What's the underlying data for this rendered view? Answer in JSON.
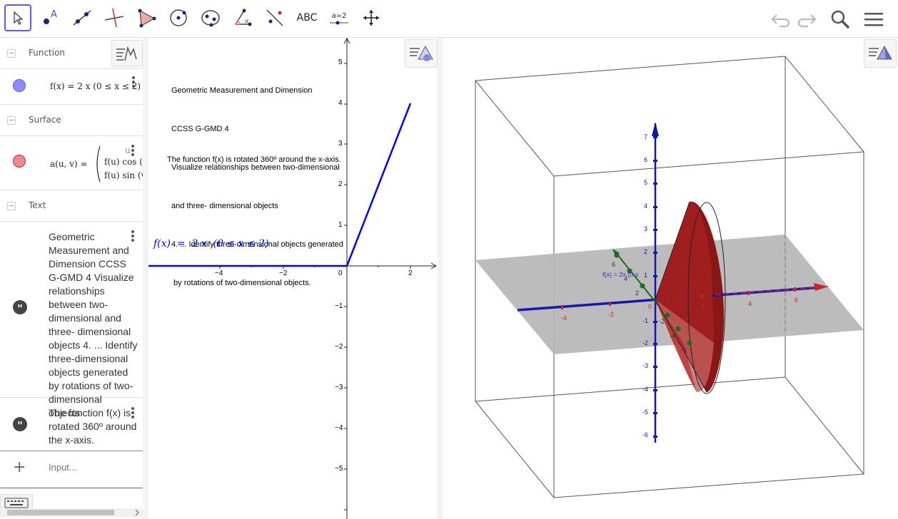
{
  "toolbar": {
    "tools": [
      {
        "name": "move-tool",
        "label": ""
      },
      {
        "name": "point-tool",
        "label": ""
      },
      {
        "name": "line-tool",
        "label": ""
      },
      {
        "name": "perpendicular-line-tool",
        "label": ""
      },
      {
        "name": "polygon-tool",
        "label": ""
      },
      {
        "name": "circle-tool",
        "label": ""
      },
      {
        "name": "ellipse-tool",
        "label": ""
      },
      {
        "name": "angle-tool",
        "label": ""
      },
      {
        "name": "reflect-tool",
        "label": ""
      },
      {
        "name": "text-tool",
        "label": "ABC"
      },
      {
        "name": "slider-tool",
        "label": "a=2"
      },
      {
        "name": "move-graphics-view-tool",
        "label": ""
      }
    ]
  },
  "algebra": {
    "sections": [
      {
        "title": "Function"
      },
      {
        "title": "Surface"
      },
      {
        "title": "Text"
      }
    ],
    "function_row": {
      "formula": "f(x)  =  2 x  (0 ≤ x ≤ 2)",
      "color": "#6f6fff"
    },
    "surface_row": {
      "lhs": "a(u, v)  =",
      "line1": "f(u)  cos (",
      "line2": "f(u)  sin (v",
      "corner": "u",
      "color": "#e86a6a"
    },
    "text_row_1": "Geometric Measurement and Dimension CCSS G-GMD 4 Visualize relationships between two-dimensional and three- dimensional objects 4. ... Identify three-dimensional objects generated by rotations of two-dimensional objects.",
    "text_row_2": "The function f(x) is rotated 360º around the x-axis.",
    "input_placeholder": "Input..."
  },
  "graphics2d": {
    "text_lines": [
      "Geometric Measurement and Dimension",
      "CCSS G-GMD 4",
      "Visualize relationships between two-dimensional",
      "and three- dimensional objects",
      "4. ... Identify three-dimensional objects generated",
      " by rotations of two-dimensional objects."
    ],
    "rotation_text": "The function f(x) is rotated 360º around the x-axis.",
    "function_label": "f(x)  =  2 x  (0 ≤ x ≤ 2)",
    "x_ticks": [
      "−4",
      "−2",
      "0",
      "2"
    ],
    "y_ticks": [
      "5",
      "4",
      "3",
      "2",
      "1",
      "−1",
      "−2",
      "−3",
      "−4",
      "−5"
    ],
    "line_color": "#0000ff"
  },
  "graphics3d": {
    "label": "f(x) = 2x (0 ≤",
    "z_ticks": [
      "7",
      "6",
      "5",
      "4",
      "3",
      "2",
      "1",
      "-1",
      "-2",
      "-3",
      "-4",
      "-5",
      "-6"
    ],
    "x_ticks": [
      "-4",
      "-2",
      "0",
      "2",
      "4",
      "6"
    ],
    "y_ticks": [
      "6",
      "4",
      "2",
      "-2",
      "-4",
      "-6"
    ],
    "cone_color": "#a02020"
  }
}
